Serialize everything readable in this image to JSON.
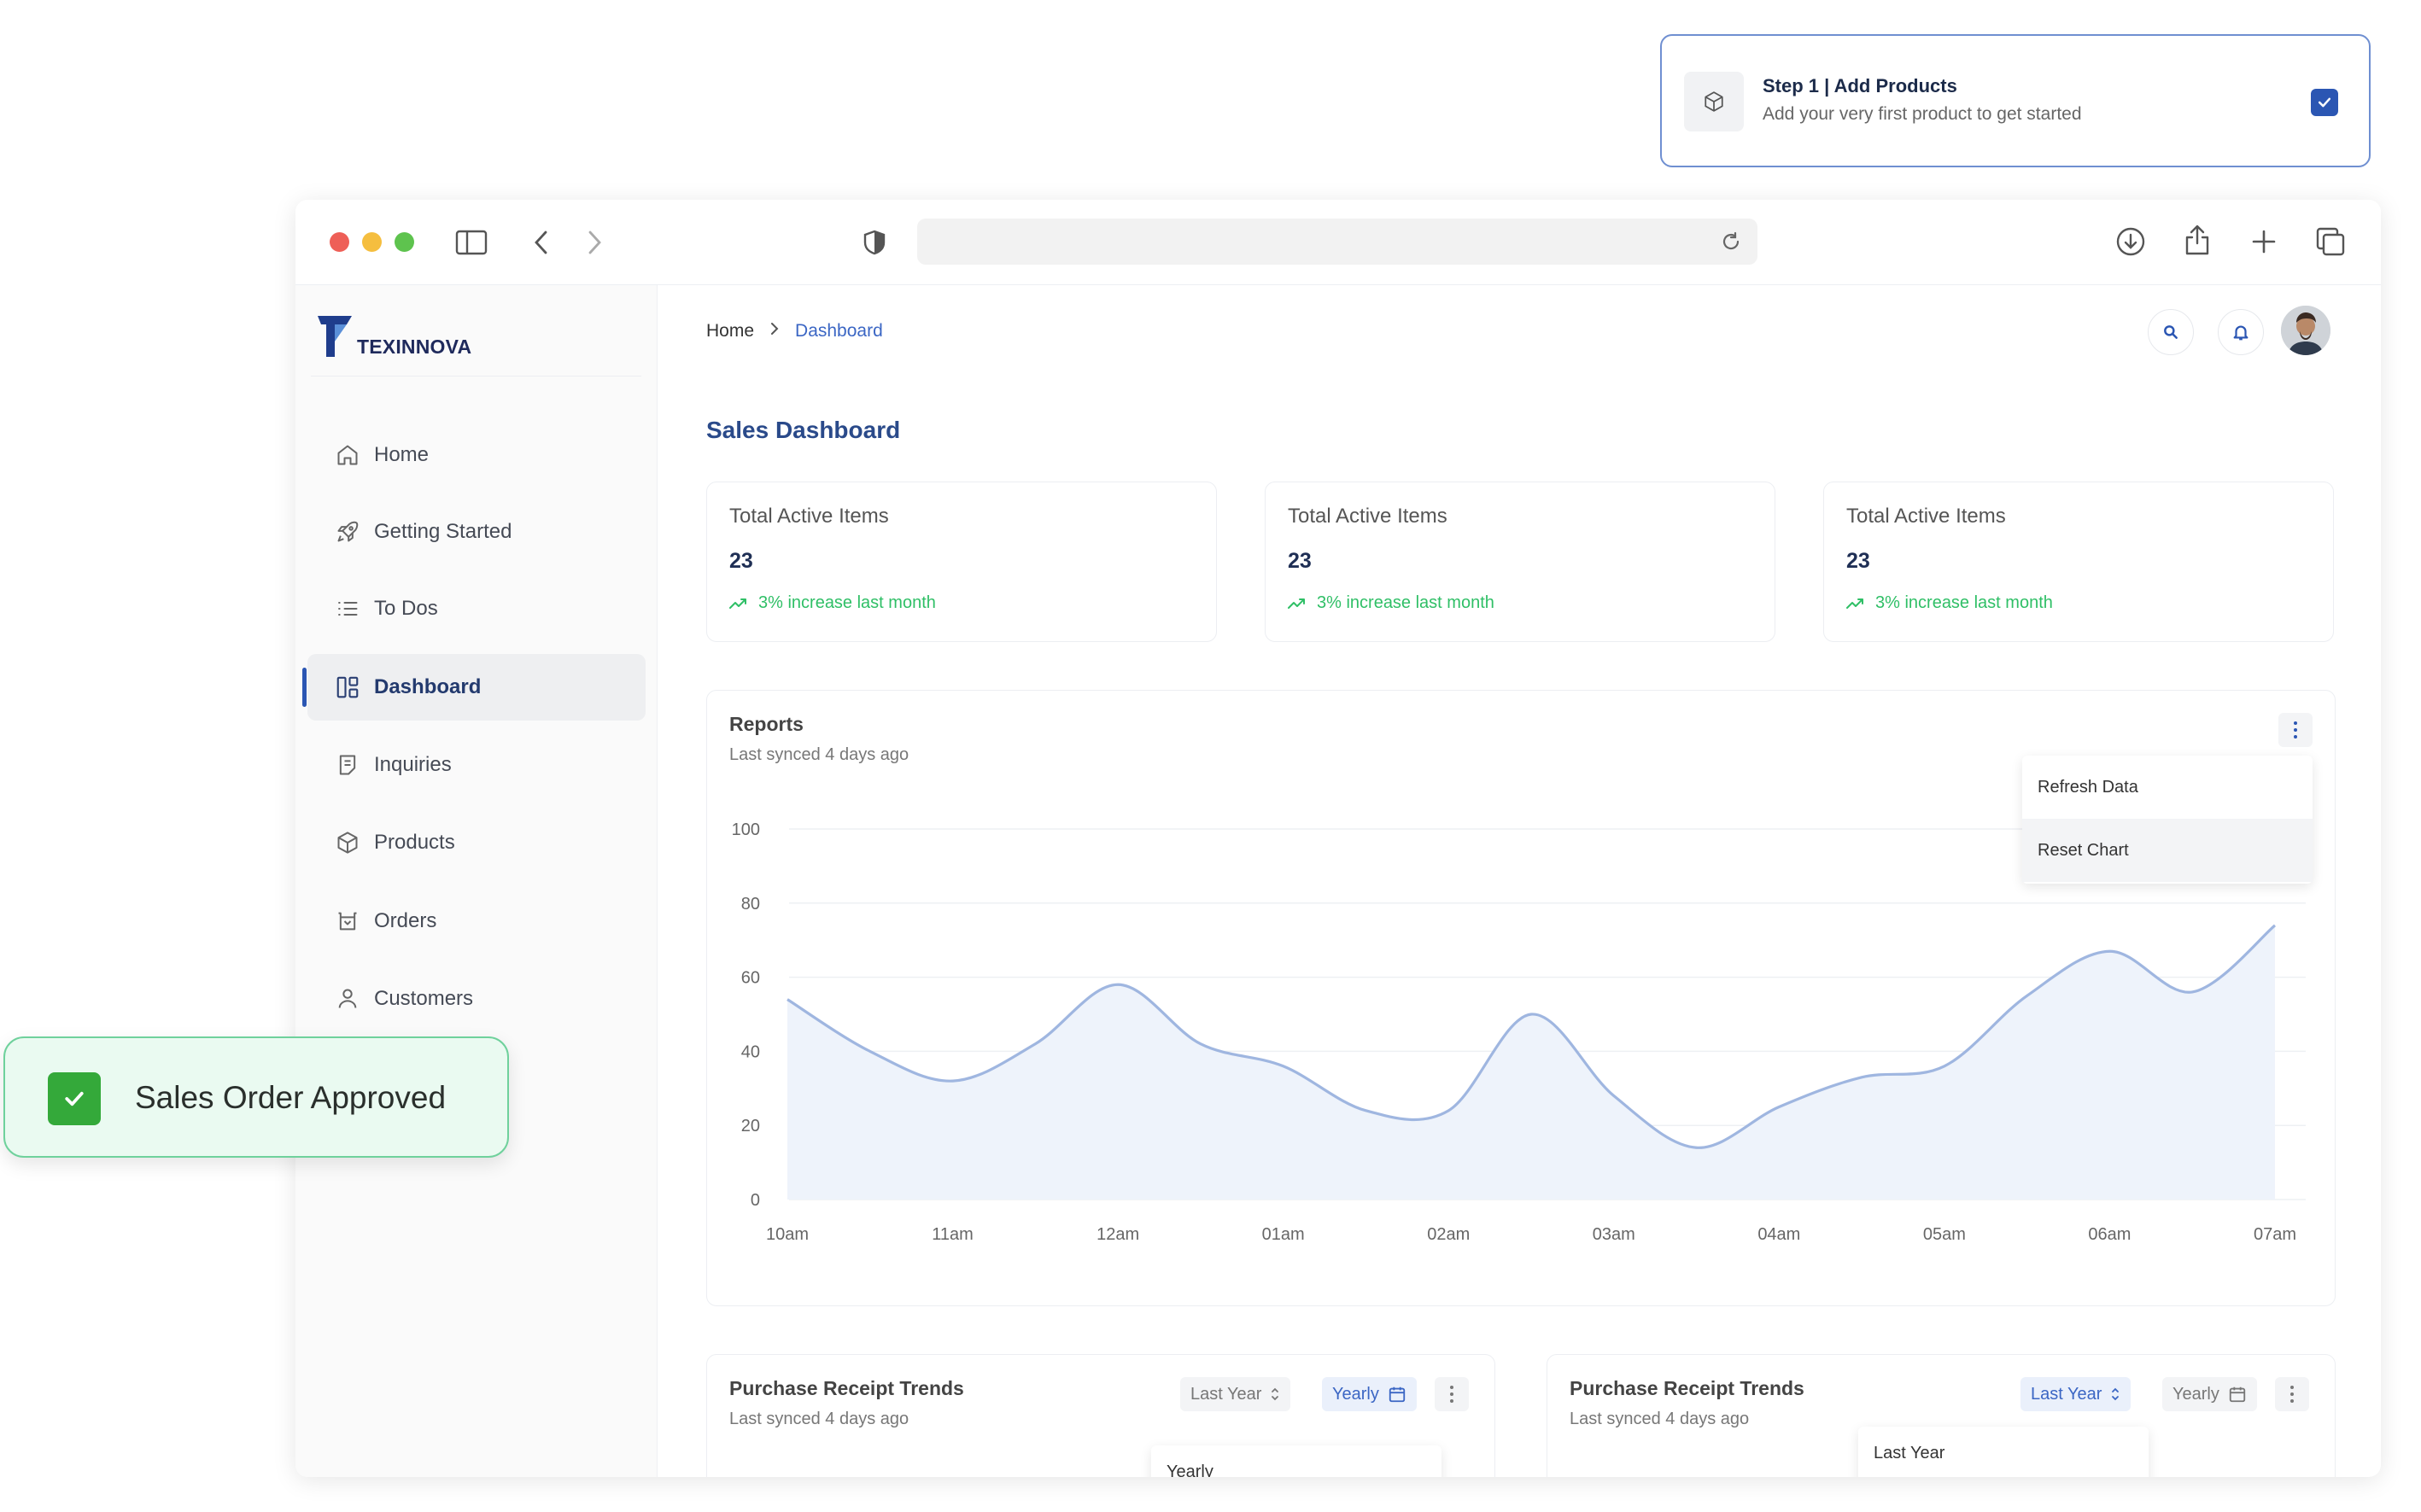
{
  "step_card": {
    "title": "Step 1 | Add Products",
    "subtitle": "Add your very first product to get started",
    "icon": "package-icon",
    "checked": true
  },
  "browser": {
    "traffic_lights": [
      "#ee5f57",
      "#f5be3f",
      "#5ec34e"
    ],
    "icons": [
      "sidebar-toggle-icon",
      "chevron-left-icon",
      "chevron-right-icon",
      "shield-icon",
      "reload-icon",
      "download-icon",
      "share-icon",
      "plus-icon",
      "tabs-icon"
    ]
  },
  "sidebar": {
    "logo_text": "TEXINNOVA",
    "items": [
      {
        "label": "Home",
        "icon": "home-icon"
      },
      {
        "label": "Getting Started",
        "icon": "rocket-icon"
      },
      {
        "label": "To Dos",
        "icon": "list-icon"
      },
      {
        "label": "Dashboard",
        "icon": "dashboard-icon",
        "active": true
      },
      {
        "label": "Inquiries",
        "icon": "document-icon"
      },
      {
        "label": "Products",
        "icon": "package-icon"
      },
      {
        "label": "Orders",
        "icon": "tray-icon"
      },
      {
        "label": "Customers",
        "icon": "user-icon"
      }
    ]
  },
  "header": {
    "breadcrumb": {
      "home": "Home",
      "current": "Dashboard"
    },
    "icons": [
      "search-icon",
      "bell-icon",
      "avatar"
    ]
  },
  "page": {
    "title": "Sales Dashboard",
    "stats": [
      {
        "label": "Total Active Items",
        "value": "23",
        "trend": "3% increase last month"
      },
      {
        "label": "Total Active Items",
        "value": "23",
        "trend": "3% increase last month"
      },
      {
        "label": "Total Active Items",
        "value": "23",
        "trend": "3% increase last month"
      }
    ]
  },
  "reports": {
    "title": "Reports",
    "subtitle": "Last synced 4 days ago",
    "menu": [
      "Refresh Data",
      "Reset Chart"
    ]
  },
  "chart_data": {
    "type": "area",
    "title": "",
    "xlabel": "",
    "ylabel": "",
    "x": [
      "10am",
      "10:30am",
      "11am",
      "11:30am",
      "12am",
      "12:30am",
      "01am",
      "01:30am",
      "02am",
      "02:30am",
      "03am",
      "03:30am",
      "04am",
      "04:30am",
      "05am",
      "05:30am",
      "06am",
      "06:30am",
      "07am"
    ],
    "x_ticks": [
      "10am",
      "11am",
      "12am",
      "01am",
      "02am",
      "03am",
      "04am",
      "05am",
      "06am",
      "07am"
    ],
    "series": [
      {
        "values": [
          54,
          40,
          32,
          42,
          58,
          42,
          36,
          24,
          24,
          50,
          28,
          14,
          25,
          33,
          36,
          55,
          67,
          56,
          74
        ]
      }
    ],
    "ylim": [
      0,
      100
    ],
    "y_ticks": [
      0,
      20,
      40,
      60,
      80,
      100
    ],
    "grid": true,
    "colors": {
      "line": "#9fb6e0",
      "fill": "#eef3fb"
    }
  },
  "bottom_cards": [
    {
      "title": "Purchase Receipt Trends",
      "subtitle": "Last synced 4 days ago",
      "period_select": "Last Year",
      "granularity": "Yearly",
      "open_menu_item": "Yearly"
    },
    {
      "title": "Purchase Receipt Trends",
      "subtitle": "Last synced 4 days ago",
      "period_select": "Last Year",
      "granularity": "Yearly",
      "open_menu_item": "Last Year"
    }
  ],
  "toast": {
    "text": "Sales Order Approved",
    "icon": "check-icon"
  }
}
